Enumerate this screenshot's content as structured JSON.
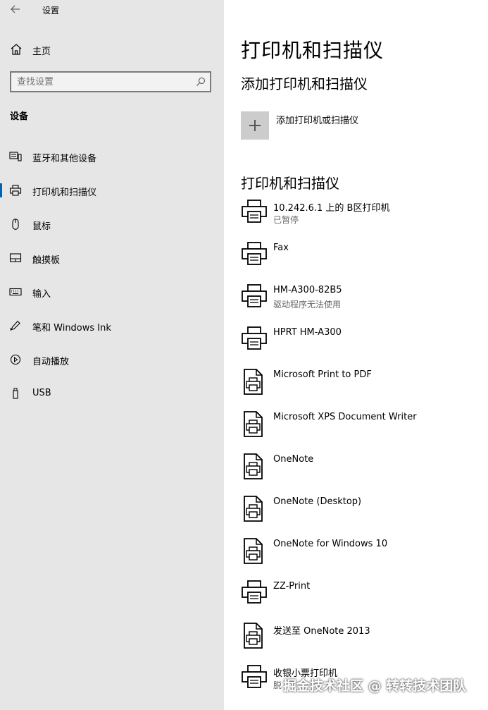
{
  "window": {
    "title": "设置"
  },
  "sidebar": {
    "home_label": "主页",
    "search": {
      "placeholder": "查找设置",
      "value": ""
    },
    "section_title": "设备",
    "items": [
      {
        "label": "蓝牙和其他设备",
        "icon": "bluetooth-devices-icon",
        "active": false
      },
      {
        "label": "打印机和扫描仪",
        "icon": "printer-icon",
        "active": true
      },
      {
        "label": "鼠标",
        "icon": "mouse-icon",
        "active": false
      },
      {
        "label": "触摸板",
        "icon": "touchpad-icon",
        "active": false
      },
      {
        "label": "输入",
        "icon": "keyboard-icon",
        "active": false
      },
      {
        "label": "笔和 Windows Ink",
        "icon": "pen-icon",
        "active": false
      },
      {
        "label": "自动播放",
        "icon": "autoplay-icon",
        "active": false
      },
      {
        "label": "USB",
        "icon": "usb-icon",
        "active": false
      }
    ]
  },
  "main": {
    "title": "打印机和扫描仪",
    "add_heading": "添加打印机和扫描仪",
    "add_label": "添加打印机或扫描仪",
    "list_heading": "打印机和扫描仪",
    "devices": [
      {
        "name": "10.242.6.1 上的 B区打印机",
        "status": "已暂停",
        "icon": "printer-icon"
      },
      {
        "name": "Fax",
        "status": "",
        "icon": "printer-icon"
      },
      {
        "name": "HM-A300-82B5",
        "status": "驱动程序无法使用",
        "icon": "printer-icon"
      },
      {
        "name": "HPRT HM-A300",
        "status": "",
        "icon": "printer-icon"
      },
      {
        "name": "Microsoft Print to PDF",
        "status": "",
        "icon": "document-printer-icon"
      },
      {
        "name": "Microsoft XPS Document Writer",
        "status": "",
        "icon": "document-printer-icon"
      },
      {
        "name": "OneNote",
        "status": "",
        "icon": "document-printer-icon"
      },
      {
        "name": "OneNote (Desktop)",
        "status": "",
        "icon": "document-printer-icon"
      },
      {
        "name": "OneNote for Windows 10",
        "status": "",
        "icon": "document-printer-icon"
      },
      {
        "name": "ZZ-Print",
        "status": "",
        "icon": "printer-icon"
      },
      {
        "name": "发送至 OneNote 2013",
        "status": "",
        "icon": "document-printer-icon"
      },
      {
        "name": "收银小票打印机",
        "status": "脱",
        "icon": "printer-icon"
      }
    ]
  },
  "watermark": "掘金技术社区 @ 转转技术团队",
  "colors": {
    "sidebar_bg": "#e6e6e6",
    "accent": "#0063b1",
    "tile_bg": "#cccccc"
  }
}
